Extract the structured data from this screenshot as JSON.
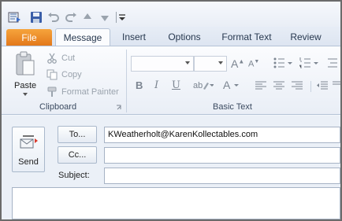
{
  "tabs": {
    "file": "File",
    "message": "Message",
    "insert": "Insert",
    "options": "Options",
    "format_text": "Format Text",
    "review": "Review"
  },
  "clipboard": {
    "paste": "Paste",
    "cut": "Cut",
    "copy": "Copy",
    "format_painter": "Format Painter",
    "group_label": "Clipboard"
  },
  "basic_text": {
    "group_label": "Basic Text",
    "bold": "B",
    "italic": "I",
    "underline": "U"
  },
  "compose": {
    "send_label": "Send",
    "to_label": "To...",
    "cc_label": "Cc...",
    "subject_label": "Subject:",
    "to_value": "KWeatherholt@KarenKollectables.com",
    "cc_value": "",
    "subject_value": ""
  },
  "colors": {
    "file_tab": "#e3791b",
    "ribbon_bg": "#fbfcfe",
    "accent_text": "#27384f"
  }
}
